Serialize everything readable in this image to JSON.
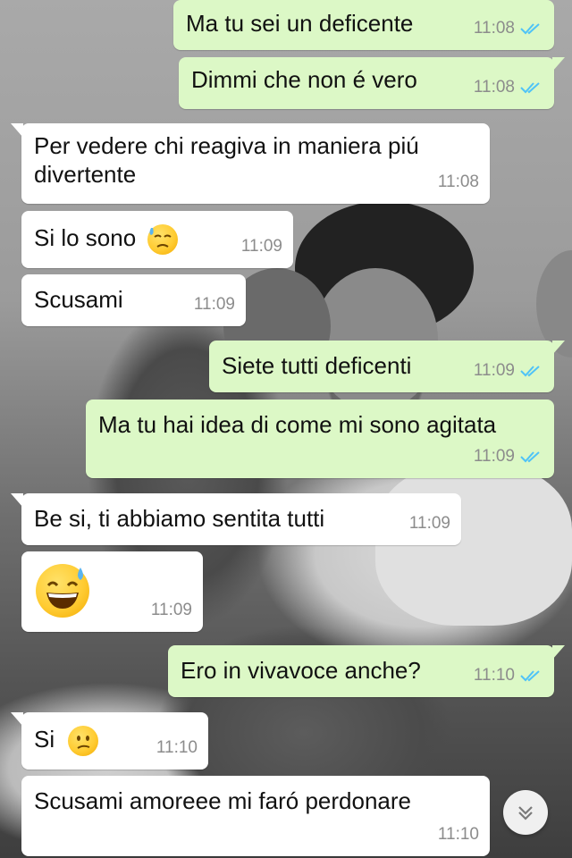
{
  "chat": {
    "messages": [
      {
        "text": "Ma tu sei un deficente",
        "time": "11:08",
        "direction": "out",
        "status": "read"
      },
      {
        "text": "Dimmi che non é vero",
        "time": "11:08",
        "direction": "out",
        "status": "read"
      },
      {
        "text": "Per vedere chi reagiva in maniera piú divertente",
        "time": "11:08",
        "direction": "in"
      },
      {
        "text": "Si lo sono",
        "emoji": "face-with-cold-sweat",
        "time": "11:09",
        "direction": "in"
      },
      {
        "text": "Scusami",
        "time": "11:09",
        "direction": "in"
      },
      {
        "text": "Siete tutti deficenti",
        "time": "11:09",
        "direction": "out",
        "status": "read"
      },
      {
        "text": "Ma tu hai idea di come mi sono agitata",
        "time": "11:09",
        "direction": "out",
        "status": "read"
      },
      {
        "text": "Be si, ti abbiamo sentita tutti",
        "time": "11:09",
        "direction": "in"
      },
      {
        "text": "",
        "emoji": "grinning-face-with-sweat",
        "time": "11:09",
        "direction": "in"
      },
      {
        "text": "Ero in vivavoce anche?",
        "time": "11:10",
        "direction": "out",
        "status": "read"
      },
      {
        "text": "Si",
        "emoji": "confused-face",
        "time": "11:10",
        "direction": "in"
      },
      {
        "text": "Scusami amoreee mi faró perdonare",
        "time": "11:10",
        "direction": "in"
      }
    ]
  },
  "scroll_button": {
    "icon": "double-chevron-down-icon"
  },
  "colors": {
    "incoming_bubble": "#ffffff",
    "outgoing_bubble": "#dcf8c6",
    "read_ticks": "#4fc3f7",
    "timestamp": "#8c8c8c"
  }
}
